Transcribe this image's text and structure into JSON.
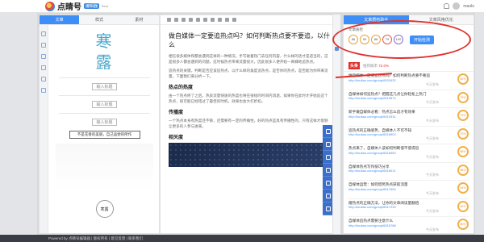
{
  "app": {
    "logo_text": "点睛号",
    "logo_badge": "编辑器",
    "logo_sub": "Beta",
    "user": "maolo"
  },
  "left_panel": {
    "tabs": [
      "文章",
      "样式",
      "素材"
    ],
    "title_chars": "寒\n露",
    "labels": {
      "l1": "输入标题",
      "l2": "输入标题",
      "l3": "输入标题"
    },
    "note": "不是花香的美丽，自己品尝的所作",
    "circle_btn": "寒露"
  },
  "editor": {
    "title": "做自媒体一定要追热点吗？如何判断热点要不要追，以什么",
    "p1": "相信很多媒体和都会遇到这样的一种情况，手写碰着热门去任何内容，什么样的话才是适当的，这是很多人都会遇到的问题，这时候热点带来流量很大，因此很多人便开始一窝蜂地追热点。",
    "p2": "追热点的关键，判断是否应该追热点，以什么样的角度追热点，是否你的热点，是否能为你带来流量。下面我们来分析一下。",
    "h1": "热点的热度",
    "p3": "由一个热点终了之后，热衷流量快速的热度也将在很短的时间内消退，如果你在此时才开始追这个热点，很可能已经错过了最佳的时机，效果也会大打折扣。",
    "h2": "传播度",
    "p4": "一个热点本身有热度还不够，还需要有一定的传播性，好的热点是具有传播性的，只有这样才能够让更多的人参与进来。",
    "h3": "相关度"
  },
  "right_panel": {
    "tabs": [
      "文章质检助手",
      "文章风格优化"
    ],
    "quality_label": "文章质检",
    "scores": [
      "86",
      "90",
      "88",
      "79",
      "100"
    ],
    "check_button": "开始检测",
    "toutiao_logo": "头条",
    "toutiao_info_label": "推荐概率",
    "toutiao_info_value": "72.0%",
    "articles": [
      {
        "title": "做自媒体一定要追热点吗？如何判断热点要不要追",
        "url": "http://toutiao.com/group/6520432",
        "meta": "今天发布",
        "score": "80%"
      },
      {
        "title": "自媒体如何追热点？把握这几点让你轻松上热门",
        "url": "http://toutiao.com/group/6519874",
        "meta": "今天发布",
        "score": "75%"
      },
      {
        "title": "新手做自媒体必看：热点怎么追才有效果",
        "url": "http://toutiao.com/group/6519331",
        "meta": "今天发布",
        "score": "73%"
      },
      {
        "title": "追热点的正确姿势，自媒体人不可不知",
        "url": "http://toutiao.com/group/6518902",
        "meta": "今天发布",
        "score": "70%"
      },
      {
        "title": "热点来了，自媒体人该如何判断值不值得追",
        "url": "http://toutiao.com/group/6518450",
        "meta": "今天发布",
        "score": "68%"
      },
      {
        "title": "自媒体热点写作技巧分享",
        "url": "http://toutiao.com/group/6518011",
        "meta": "今天发布",
        "score": "66%"
      },
      {
        "title": "自媒体运营：如何借势热点获取流量",
        "url": "http://toutiao.com/group/6517654",
        "meta": "今天发布",
        "score": "64%"
      },
      {
        "title": "蹭热点的正确方法，让你的文章阅读量翻倍",
        "url": "http://toutiao.com/group/6517230",
        "meta": "今天发布",
        "score": "62%"
      },
      {
        "title": "自媒体追热点需要注意什么",
        "url": "http://toutiao.com/group/6516788",
        "meta": "今天发布",
        "score": "60%"
      }
    ]
  },
  "statusbar": {
    "text": "Powered by 点睛号编辑器 | 版权所有 | 意见反馈 | 联系我们"
  }
}
